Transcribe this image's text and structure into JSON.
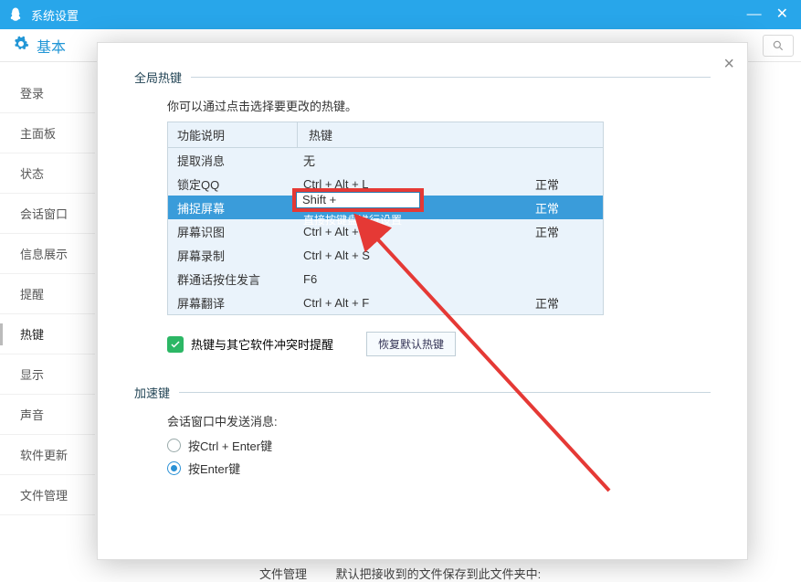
{
  "window": {
    "title": "系统设置"
  },
  "toprow": {
    "category": "基本"
  },
  "sidebar": {
    "items": [
      {
        "label": "登录"
      },
      {
        "label": "主面板"
      },
      {
        "label": "状态"
      },
      {
        "label": "会话窗口"
      },
      {
        "label": "信息展示"
      },
      {
        "label": "提醒"
      },
      {
        "label": "热键"
      },
      {
        "label": "显示"
      },
      {
        "label": "声音"
      },
      {
        "label": "软件更新"
      },
      {
        "label": "文件管理"
      }
    ],
    "current_index": 6
  },
  "bottom_section": {
    "label": "文件管理",
    "desc": "默认把接收到的文件保存到此文件夹中:"
  },
  "modal": {
    "global_hotkeys": {
      "heading": "全局热键",
      "hint": "你可以通过点击选择要更改的热键。",
      "cols": {
        "func": "功能说明",
        "hotkey": "热键"
      },
      "rows": [
        {
          "func": "提取消息",
          "hotkey": "无",
          "status": ""
        },
        {
          "func": "锁定QQ",
          "hotkey": "Ctrl + Alt + L",
          "status": "正常"
        },
        {
          "func": "捕捉屏幕",
          "hotkey": "Shift +",
          "status": "正常",
          "editing": true,
          "hint2": "直接按键盘进行设置"
        },
        {
          "func": "屏幕识图",
          "hotkey": "Ctrl + Alt + O",
          "status": "正常"
        },
        {
          "func": "屏幕录制",
          "hotkey": "Ctrl + Alt + S",
          "status": ""
        },
        {
          "func": "群通话按住发言",
          "hotkey": "F6",
          "status": ""
        },
        {
          "func": "屏幕翻译",
          "hotkey": "Ctrl + Alt + F",
          "status": "正常"
        }
      ],
      "conflict_label": "热键与其它软件冲突时提醒",
      "restore_label": "恢复默认热键"
    },
    "accel": {
      "heading": "加速键",
      "prompt": "会话窗口中发送消息:",
      "options": [
        {
          "label": "按Ctrl + Enter键",
          "checked": false
        },
        {
          "label": "按Enter键",
          "checked": true
        }
      ]
    }
  }
}
